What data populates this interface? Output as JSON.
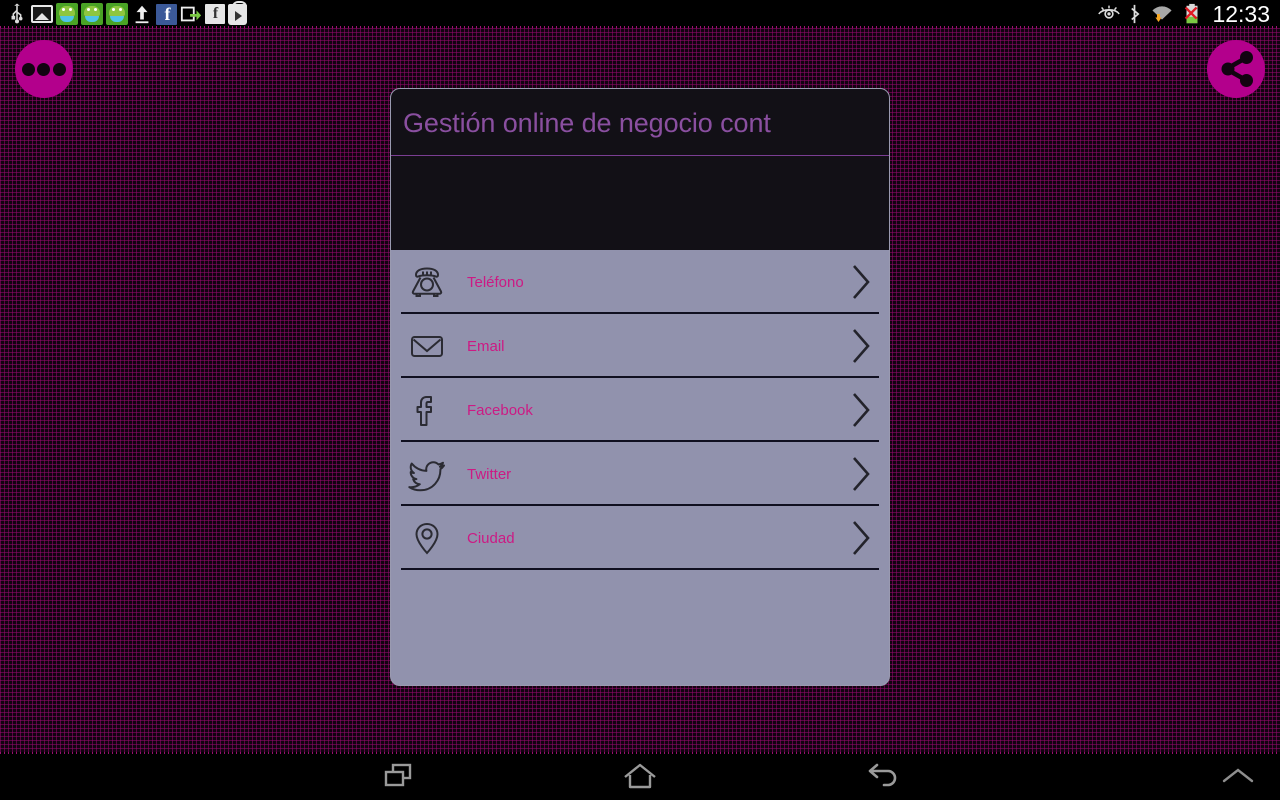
{
  "statusbar": {
    "time": "12:33",
    "left_icons": [
      {
        "name": "usb-icon",
        "label": "USB"
      },
      {
        "name": "gallery-icon",
        "label": "Gallery"
      },
      {
        "name": "app-notification-icon-1",
        "label": "App"
      },
      {
        "name": "app-notification-icon-2",
        "label": "App"
      },
      {
        "name": "app-notification-icon-3",
        "label": "App"
      },
      {
        "name": "upload-icon",
        "label": "Upload"
      },
      {
        "name": "facebook-blue-icon",
        "label": "f"
      },
      {
        "name": "share-export-icon",
        "label": "Export"
      },
      {
        "name": "facebook-white-icon",
        "label": "f"
      },
      {
        "name": "play-store-icon",
        "label": "Play Store"
      }
    ],
    "right_icons": [
      {
        "name": "smart-stay-eye-icon",
        "label": "Smart stay"
      },
      {
        "name": "bluetooth-icon",
        "label": "Bluetooth"
      },
      {
        "name": "wifi-download-icon",
        "label": "Wi-Fi"
      },
      {
        "name": "battery-disconnected-icon",
        "label": "Battery"
      }
    ]
  },
  "overlay": {
    "menu_button_name": "overflow-menu-button",
    "share_button_name": "share-button",
    "accent_color": "#b3008c"
  },
  "card": {
    "title": "Gestión online de negocio cont",
    "title_color": "#8a4fa0",
    "header_bg": "#121016",
    "body_bg": "#9192ad",
    "label_color": "#cc1a84",
    "items": [
      {
        "label": "Teléfono",
        "icon": "phone-icon"
      },
      {
        "label": "Email",
        "icon": "envelope-icon"
      },
      {
        "label": "Facebook",
        "icon": "facebook-icon"
      },
      {
        "label": "Twitter",
        "icon": "twitter-bird-icon"
      },
      {
        "label": "Ciudad",
        "icon": "map-pin-icon"
      }
    ]
  },
  "navbar": {
    "buttons": [
      {
        "name": "recent-apps-button",
        "label": "Recents"
      },
      {
        "name": "home-button",
        "label": "Home"
      },
      {
        "name": "back-button",
        "label": "Back"
      },
      {
        "name": "expand-navbar-button",
        "label": "Expand"
      }
    ]
  }
}
